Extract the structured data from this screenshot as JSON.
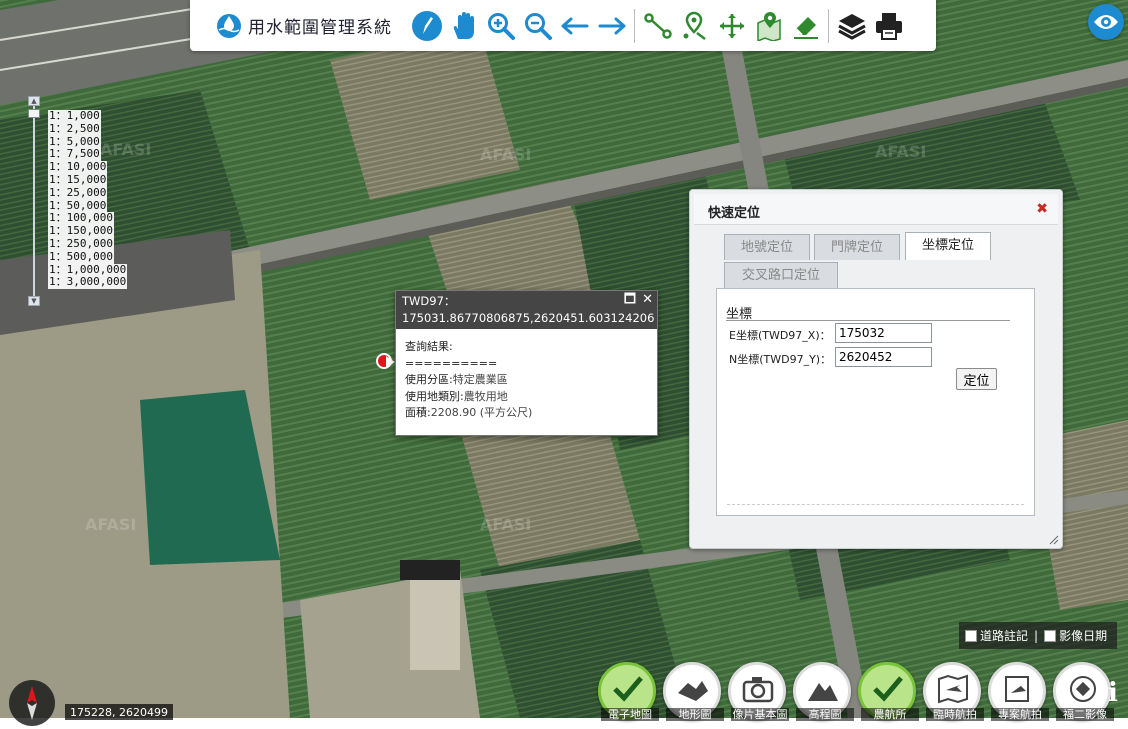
{
  "app": {
    "title": "用水範圍管理系統"
  },
  "toolbar": {
    "tools": [
      "pencil-icon",
      "pan-hand-icon",
      "zoom-in-icon",
      "zoom-out-icon",
      "back-arrow-icon",
      "forward-arrow-icon",
      "measure-distance-icon",
      "measure-area-icon",
      "move-icon",
      "map-pin-icon",
      "eraser-icon",
      "layers-icon",
      "print-icon"
    ]
  },
  "scale": {
    "items": [
      "1：1,000",
      "1：2,500",
      "1：5,000",
      "1：7,500",
      "1：10,000",
      "1：15,000",
      "1：25,000",
      "1：50,000",
      "1：100,000",
      "1：150,000",
      "1：250,000",
      "1：500,000",
      "1：1,000,000",
      "1：3,000,000"
    ]
  },
  "map": {
    "watermark": "AFASI"
  },
  "popup": {
    "header_label": "TWD97：",
    "header_coords": "175031.86770806875,2620451.603124206",
    "query_title": "查詢結果:",
    "divider": "==========",
    "zone_label": "使用分區:",
    "zone_value": "特定農業區",
    "landuse_label": "使用地類別:",
    "landuse_value": "農牧用地",
    "area_label": "面積:",
    "area_value": "2208.90",
    "area_unit": "(平方公尺)"
  },
  "panel": {
    "title": "快速定位",
    "tabs": [
      "地號定位",
      "門牌定位",
      "坐標定位",
      "交叉路口定位"
    ],
    "active_tab": "坐標定位",
    "section_title": "坐標",
    "e_label": "E坐標(TWD97_X)：",
    "e_value": "175032",
    "n_label": "N坐標(TWD97_Y)：",
    "n_value": "2620452",
    "locate_button": "定位"
  },
  "layers": {
    "road_label": "道路註記",
    "image_date_label": "影像日期",
    "separator": "|"
  },
  "basemaps": {
    "items": [
      "電子地圖",
      "地形圖",
      "像片基本圖",
      "高程圖",
      "農航所",
      "臨時航拍",
      "專案航拍",
      "福二影像"
    ],
    "selected": [
      "電子地圖",
      "農航所"
    ]
  },
  "status": {
    "coords": "175228, 2620499"
  },
  "colors": {
    "brand_blue": "#1e8bd0",
    "icon_green": "#2f8a2f",
    "marker_red": "#e0161d",
    "close_red": "#c8281f",
    "selected_basemap": "#79c43a"
  }
}
